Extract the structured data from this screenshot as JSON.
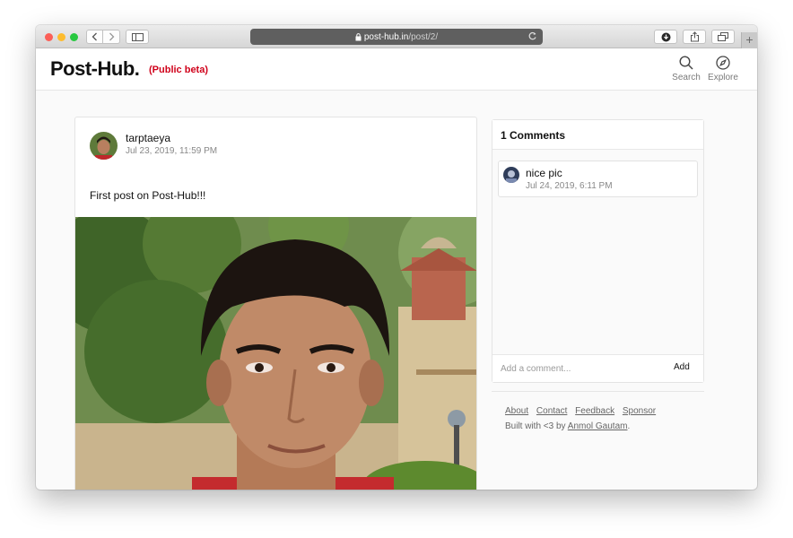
{
  "browser": {
    "url_host": "post-hub.in",
    "url_path": "/post/2/",
    "traffic_light_colors": [
      "#fc5f57",
      "#fdbc2e",
      "#28c840"
    ]
  },
  "site": {
    "logo": "Post-Hub.",
    "beta_label": "(Public beta)",
    "accent_color": "#d0021b",
    "nav": [
      {
        "label": "Search",
        "icon": "search-icon"
      },
      {
        "label": "Explore",
        "icon": "compass-icon"
      }
    ]
  },
  "post": {
    "username": "tarptaeya",
    "date": "Jul 23, 2019, 11:59 PM",
    "caption": "First post on Post-Hub!!!"
  },
  "comments": {
    "header": "1 Comments",
    "items": [
      {
        "text": "nice pic",
        "date": "Jul 24, 2019, 6:11 PM"
      }
    ],
    "input_placeholder": "Add a comment...",
    "add_label": "Add"
  },
  "footer": {
    "links": [
      "About",
      "Contact",
      "Feedback",
      "Sponsor"
    ],
    "credit_prefix": "Built with <3 by",
    "credit_name": "Anmol Gautam",
    "credit_suffix": "."
  }
}
